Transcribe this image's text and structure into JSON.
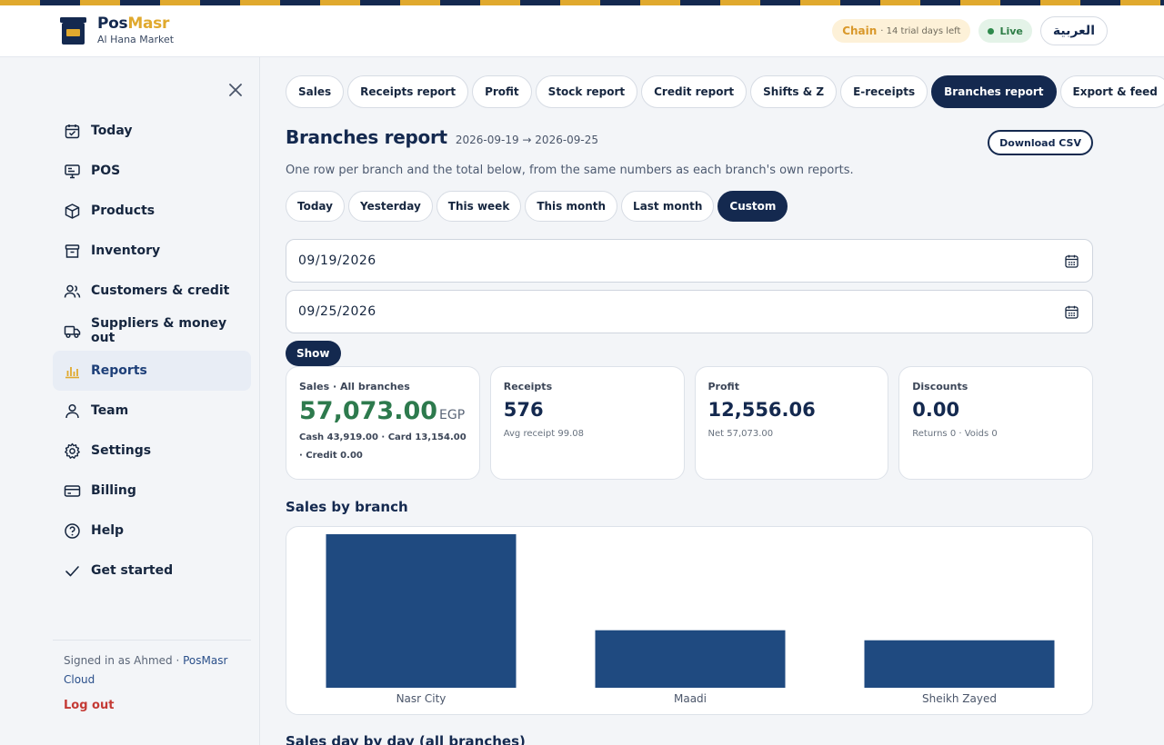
{
  "header": {
    "brand_part1": "Pos",
    "brand_part2": "Masr",
    "store_name": "Al Hana Market",
    "plan_label": "Chain",
    "trial_text": "· 14 trial days left",
    "status_label": "Live",
    "language_button": "العربية"
  },
  "sidebar": {
    "items": [
      {
        "label": "Today",
        "icon": "calendar-check-icon"
      },
      {
        "label": "POS",
        "icon": "monitor-icon"
      },
      {
        "label": "Products",
        "icon": "box-icon"
      },
      {
        "label": "Inventory",
        "icon": "archive-icon"
      },
      {
        "label": "Customers & credit",
        "icon": "users-icon"
      },
      {
        "label": "Suppliers & money out",
        "icon": "truck-icon"
      },
      {
        "label": "Reports",
        "icon": "bar-chart-icon"
      },
      {
        "label": "Team",
        "icon": "user-icon"
      },
      {
        "label": "Settings",
        "icon": "gear-icon"
      },
      {
        "label": "Billing",
        "icon": "credit-card-icon"
      },
      {
        "label": "Help",
        "icon": "help-circle-icon"
      },
      {
        "label": "Get started",
        "icon": "check-icon"
      }
    ],
    "active_index": 6,
    "signed_in_prefix": "Signed in as Ahmed · ",
    "signed_in_link": "PosMasr Cloud",
    "logout_label": "Log out"
  },
  "tabs": [
    "Sales",
    "Receipts report",
    "Profit",
    "Stock report",
    "Credit report",
    "Shifts & Z",
    "E-receipts",
    "Branches report",
    "Export & feed"
  ],
  "active_tab_index": 7,
  "page": {
    "title": "Branches report",
    "range": "2026-09-19 → 2026-09-25",
    "download_label": "Download CSV",
    "subtitle": "One row per branch and the total below, from the same numbers as each branch's own reports."
  },
  "periods": [
    "Today",
    "Yesterday",
    "This week",
    "This month",
    "Last month",
    "Custom"
  ],
  "active_period_index": 5,
  "filters": {
    "date_from": "09/19/2026",
    "date_to": "09/25/2026",
    "show_label": "Show"
  },
  "cards": {
    "sales": {
      "label": "Sales · All branches",
      "value": "57,073.00",
      "currency": "EGP",
      "sub": "Cash 43,919.00 · Card 13,154.00 · Credit 0.00"
    },
    "receipts": {
      "label": "Receipts",
      "value": "576",
      "sub": "Avg receipt 99.08"
    },
    "profit": {
      "label": "Profit",
      "value": "12,556.06",
      "sub": "Net 57,073.00"
    },
    "discounts": {
      "label": "Discounts",
      "value": "0.00",
      "sub": "Returns 0 · Voids 0"
    }
  },
  "sections": {
    "by_branch": "Sales by branch",
    "day_by_day": "Sales day by day (all branches)"
  },
  "colors": {
    "navy": "#14294f",
    "gold": "#e0a92e",
    "bar": "#1f4a80",
    "sales_green": "#2d7a4d"
  },
  "chart_data": {
    "type": "bar",
    "categories": [
      "Nasr City",
      "Maadi",
      "Sheikh Zayed"
    ],
    "values": [
      29100,
      10900,
      9000
    ],
    "ylim": [
      0,
      29100
    ],
    "grid": false,
    "legend": "none"
  }
}
